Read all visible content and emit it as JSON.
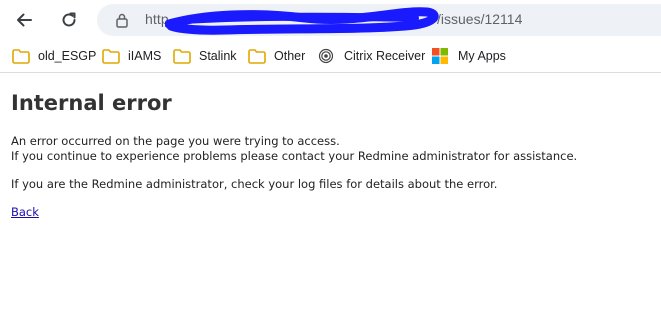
{
  "browser": {
    "url_prefix": "http",
    "url_suffix": "/issues/12114",
    "icons": {
      "back": "back-arrow-icon",
      "reload": "reload-icon",
      "lock": "lock-icon"
    }
  },
  "bookmarks": [
    {
      "label": "old_ESGP",
      "icon": "folder-icon"
    },
    {
      "label": "iIAMS",
      "icon": "folder-icon"
    },
    {
      "label": "Stalink",
      "icon": "folder-icon"
    },
    {
      "label": "Other",
      "icon": "folder-icon"
    },
    {
      "label": "Citrix Receiver",
      "icon": "citrix-icon"
    },
    {
      "label": "My Apps",
      "icon": "microsoft-icon"
    }
  ],
  "page": {
    "title": "Internal error",
    "line1": "An error occurred on the page you were trying to access.",
    "line2": "If you continue to experience problems please contact your Redmine administrator for assistance.",
    "line3": "If you are the Redmine administrator, check your log files for details about the error.",
    "back_link": "Back"
  },
  "colors": {
    "folder": "#f4c542",
    "scribble": "#1a1aff",
    "link": "#1a0dab",
    "omnibox_bg": "#eef1f6"
  }
}
